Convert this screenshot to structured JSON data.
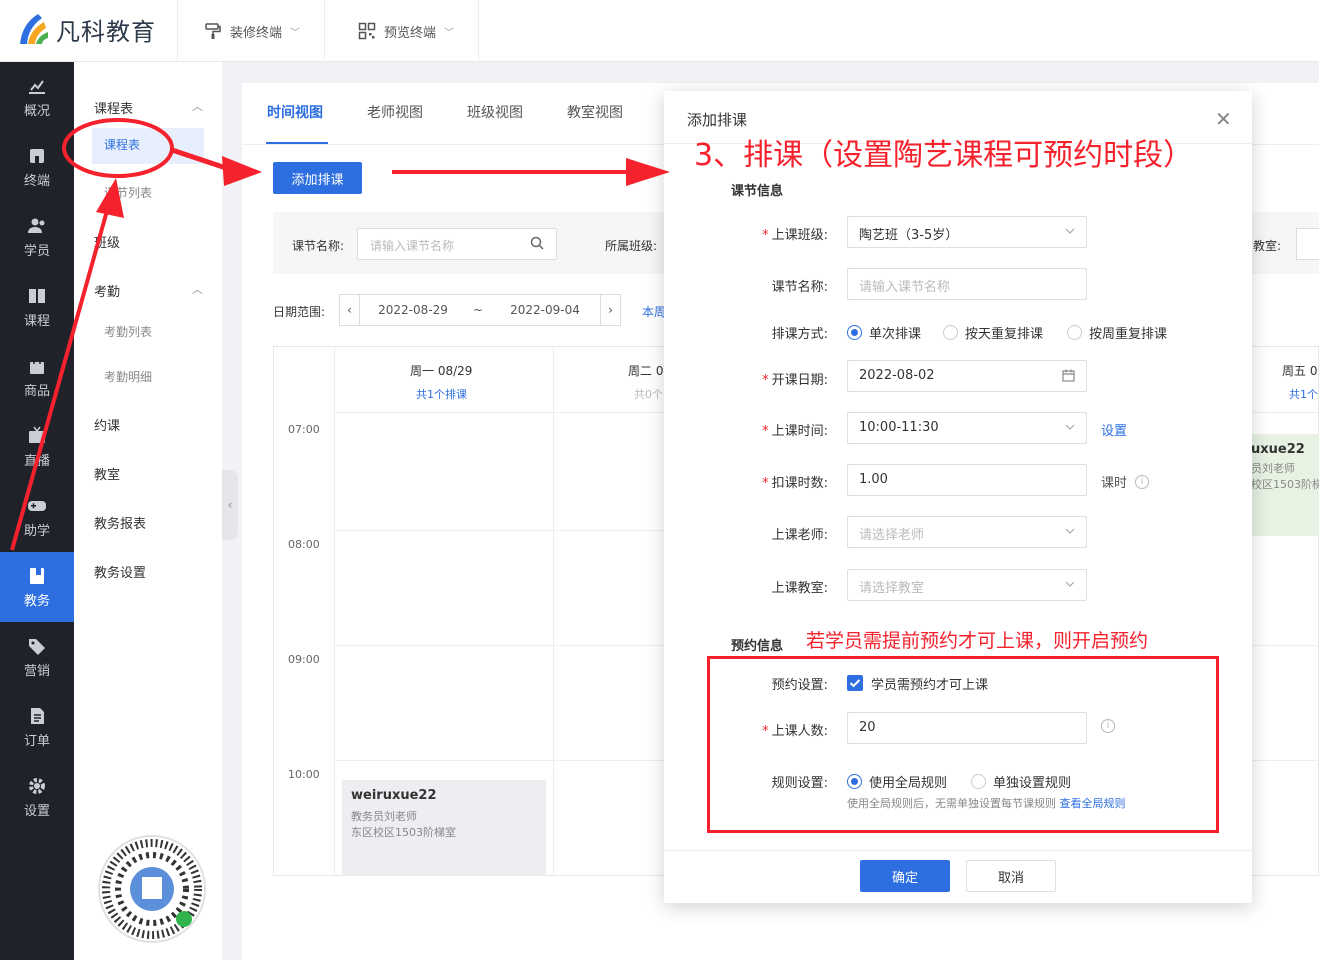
{
  "brand": {
    "name": "凡科教育"
  },
  "topbar": {
    "menu": [
      {
        "label": "装修终端"
      },
      {
        "label": "预览终端"
      }
    ]
  },
  "leftnav": [
    {
      "label": "概况"
    },
    {
      "label": "终端"
    },
    {
      "label": "学员"
    },
    {
      "label": "课程"
    },
    {
      "label": "商品"
    },
    {
      "label": "直播"
    },
    {
      "label": "助学"
    },
    {
      "label": "教务"
    },
    {
      "label": "营销"
    },
    {
      "label": "订单"
    },
    {
      "label": "设置"
    }
  ],
  "subnav": {
    "group1": "课程表",
    "item_active": "课程表",
    "item2": "课节列表",
    "item3": "班级",
    "group2": "考勤",
    "item4": "考勤列表",
    "item5": "考勤明细",
    "item6": "约课",
    "item7": "教室",
    "item8": "教务报表",
    "item9": "教务设置"
  },
  "tabs": [
    "时间视图",
    "老师视图",
    "班级视图",
    "教室视图"
  ],
  "toolbar": {
    "add_label": "添加排课"
  },
  "filters": {
    "lesson_label": "课节名称:",
    "lesson_placeholder": "请输入课节名称",
    "class_label": "所属班级:",
    "room_label": "教室:",
    "date_label": "日期范围:",
    "date_start": "2022-08-29",
    "date_sep": "~",
    "date_end": "2022-09-04",
    "this_week": "本周"
  },
  "calendar": {
    "days": [
      {
        "head": "周一 08/29",
        "count": "共1个排课"
      },
      {
        "head": "周二 0",
        "count": "共0个"
      },
      {
        "head": "周五 0",
        "count": "共1个"
      }
    ],
    "times": [
      "07:00",
      "08:00",
      "09:00",
      "10:00"
    ],
    "event1": {
      "title": "weiruxue22",
      "line1": "教务员刘老师",
      "line2": "东区校区1503阶梯室"
    },
    "event2": {
      "title": "uxue22",
      "line1": "员刘老师",
      "line2": "校区1503阶梯"
    }
  },
  "modal": {
    "title": "添加排课",
    "section_lesson": "课节信息",
    "class_label": "上课班级:",
    "class_value": "陶艺班（3-5岁）",
    "name_label": "课节名称:",
    "name_placeholder": "请输入课节名称",
    "mode_label": "排课方式:",
    "mode_options": [
      "单次排课",
      "按天重复排课",
      "按周重复排课"
    ],
    "start_label": "开课日期:",
    "start_value": "2022-08-02",
    "time_label": "上课时间:",
    "time_value": "10:00-11:30",
    "time_link": "设置",
    "hours_label": "扣课时数:",
    "hours_value": "1.00",
    "hours_unit": "课时",
    "teacher_label": "上课老师:",
    "teacher_placeholder": "请选择老师",
    "room_label": "上课教室:",
    "room_placeholder": "请选择教室",
    "section_booking": "预约信息",
    "booking_label": "预约设置:",
    "booking_check": "学员需预约才可上课",
    "capacity_label": "上课人数:",
    "capacity_value": "20",
    "rule_label": "规则设置:",
    "rule_options": [
      "使用全局规则",
      "单独设置规则"
    ],
    "rule_note": "使用全局规则后，无需单独设置每节课规则",
    "rule_link": "查看全局规则",
    "ok": "确定",
    "cancel": "取消"
  },
  "annotations": {
    "headline": "3、排课（设置陶艺课程可预约时段）",
    "booking_note": "若学员需提前预约才可上课，则开启预约"
  },
  "colors": {
    "primary": "#2d6fe0",
    "annotation": "#f5222d",
    "sidebar": "#1f2329"
  }
}
